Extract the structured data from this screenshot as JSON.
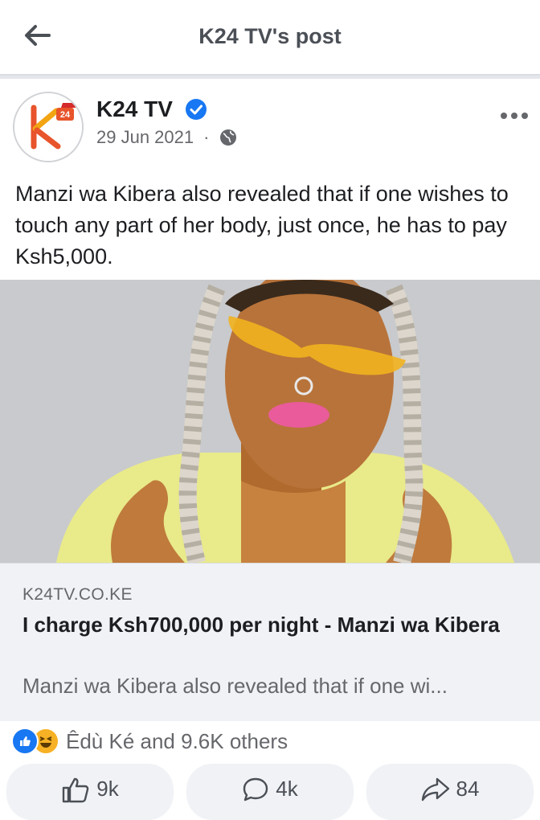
{
  "header": {
    "title": "K24 TV's post"
  },
  "post": {
    "author": "K24 TV",
    "date": "29 Jun 2021",
    "separator": "·",
    "text": "Manzi wa Kibera also revealed that if one wishes to touch any part of her body, just once, he has to pay Ksh5,000.",
    "avatar_text": "K24",
    "avatar_badge": "24"
  },
  "link_preview": {
    "domain": "K24TV.CO.KE",
    "title": "I charge Ksh700,000 per night - Manzi wa Kibera",
    "description": "Manzi wa Kibera also revealed that if one wi..."
  },
  "reactions": {
    "summary": "Êdù Ké and 9.6K others",
    "types": [
      "like-icon",
      "haha-icon"
    ]
  },
  "actions": {
    "like_count": "9k",
    "comment_count": "4k",
    "share_count": "84"
  },
  "colors": {
    "accent": "#1877f2",
    "muted": "#65676b",
    "preview_bg": "#f0f2f5"
  }
}
